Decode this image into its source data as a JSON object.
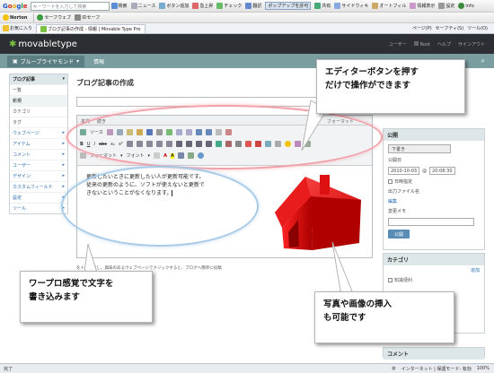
{
  "browser": {
    "google_logo": "Google",
    "search_placeholder": "キーワードを入力して検索",
    "toolbar1": [
      "検索",
      "ニュース",
      "ボタン追加",
      "急上昇",
      "チェック",
      "翻訳",
      "ポップアップを許可",
      "共有",
      "サイドウィキ",
      "オートフィル",
      "情報表示",
      "設定",
      "info"
    ],
    "norton_label": "Norton",
    "norton_items": [
      "セーフウェブ",
      "IDセーフ"
    ],
    "favorites_label": "お気に入り",
    "tab_title": "ブログ記事の作成 - 情報 | Movable Type Pro",
    "ie_menu": [
      "ページ(P)",
      "セーフティ(S)",
      "ツール(O)"
    ],
    "status_left": "完了",
    "status_zone": "インターネット | 保護モード: 有効",
    "zoom": "100%"
  },
  "mt": {
    "logo": "movabletype",
    "header_links": [
      "ユーザー",
      "Root",
      "ヘルプ",
      "サインアウト"
    ],
    "blog_name": "ブループライヤモンド",
    "blog_tab": "情報",
    "sidebar_header": "ブログ記事",
    "sidebar_items": [
      "一覧",
      "新規",
      "カテゴリ",
      "タグ",
      "ウェブページ",
      "アイテム",
      "コメント",
      "ユーザー",
      "デザイン",
      "カスタムフィールド",
      "設定",
      "ツール"
    ],
    "page_title": "ブログ記事の作成",
    "editor_tabs": [
      "本文",
      "続き"
    ],
    "format_label": "フォーマット",
    "toolbar_text_items": [
      "ソース",
      "フォーマット",
      "フォント"
    ],
    "body_text": [
      "更新したいときに更新したい人が更新可能です。",
      "従来の更新のように、ソフトが使えないと更新で",
      "きないということがなくなります。"
    ],
    "description_text": "をドラッグし、興味のあるウェブページでクリックすると、ブログへ簡単に投稿",
    "publish": {
      "header": "公開",
      "status": "下書き",
      "date_label": "公開日",
      "date": "2010-10-03",
      "time": "20:08:30",
      "auto_label": "日時指定",
      "filename_label": "出力ファイル名",
      "filename_edit": "編集",
      "memo_label": "変更メモ",
      "save_button": "公開"
    },
    "category": {
      "header": "カテゴリ",
      "add": "追加",
      "item": "知識便利"
    },
    "comment_header": "コメント"
  },
  "callouts": {
    "top_right": [
      "エディターボタンを押す",
      "だけで操作ができます"
    ],
    "bottom_left": [
      "ワープロ感覚で文字を",
      "書き込みます"
    ],
    "bottom_right": [
      "写真や画像の挿入",
      "も可能です"
    ]
  },
  "colors": {
    "mt_header": "#2b2f33",
    "blog_bar": "#7a9da0",
    "pink_ellipse": "#f2a0a8",
    "blue_ellipse": "#a8cbe8",
    "house": "#e11b1b"
  }
}
